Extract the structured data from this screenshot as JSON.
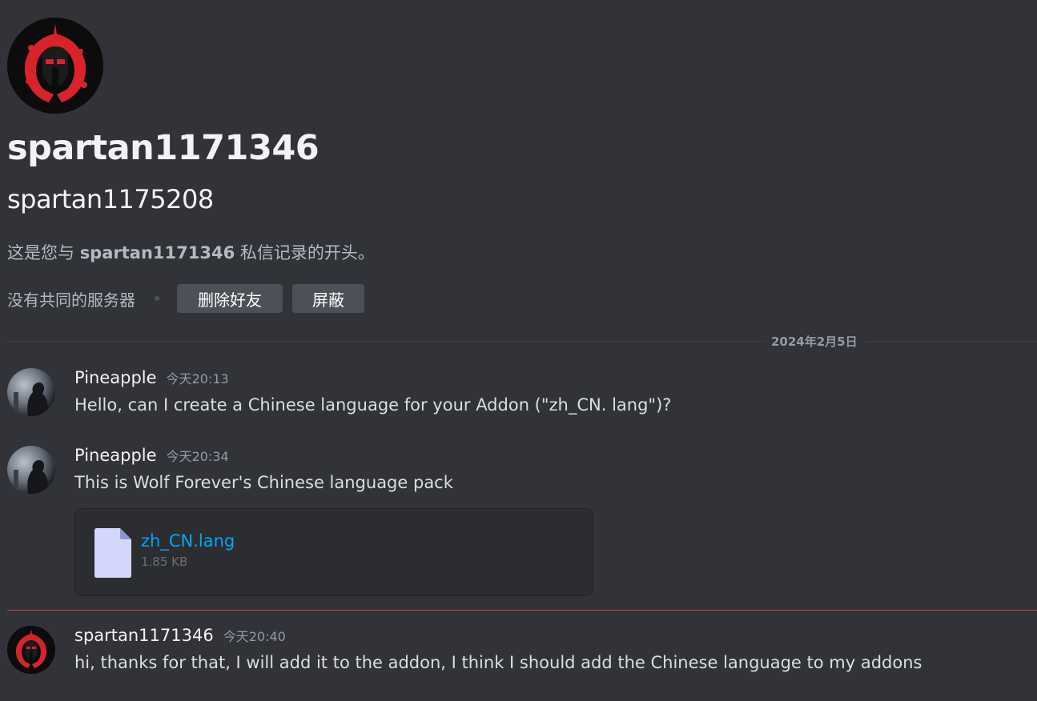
{
  "profile": {
    "display_name": "spartan1171346",
    "username": "spartan1175208",
    "intro_prefix": "这是您与 ",
    "intro_name": "spartan1171346",
    "intro_suffix": " 私信记录的开头。",
    "mutual_servers": "没有共同的服务器",
    "remove_friend_label": "删除好友",
    "block_label": "屏蔽"
  },
  "divider": {
    "date": "2024年2月5日"
  },
  "messages": [
    {
      "author": "Pineapple",
      "time": "今天20:13",
      "text": "Hello, can I create a Chinese language for your Addon (\"zh_CN. lang\")?"
    },
    {
      "author": "Pineapple",
      "time": "今天20:34",
      "text": "This is Wolf Forever's Chinese language pack",
      "attachment": {
        "file_name": "zh_CN.lang",
        "file_size": "1.85 KB"
      }
    },
    {
      "author": "spartan1171346",
      "time": "今天20:40",
      "text": "hi, thanks for that, I will add it to the addon, I think I should add the Chinese language to my addons"
    }
  ],
  "colors": {
    "background": "#313338",
    "button": "#4e5058",
    "link": "#00a8fc",
    "new_messages_line": "#c84243",
    "spartan_red": "#d8232a"
  }
}
